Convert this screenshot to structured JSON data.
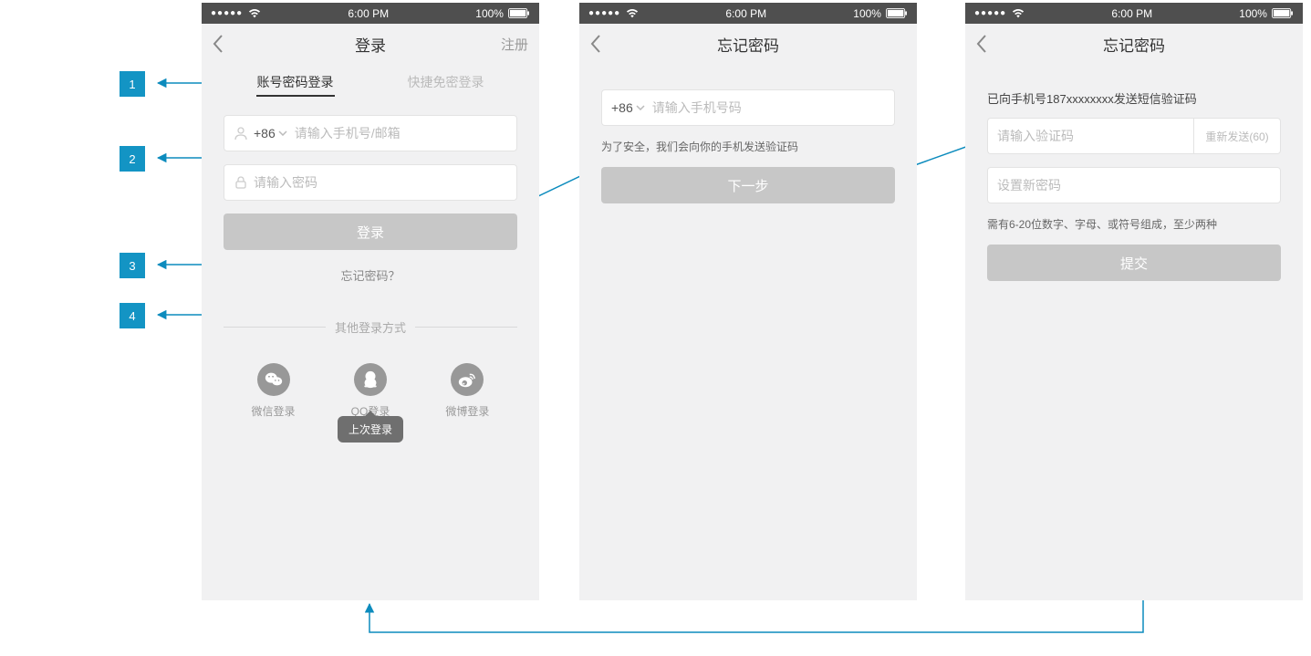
{
  "status": {
    "time": "6:00 PM",
    "battery": "100%"
  },
  "annotations": {
    "n1": "1",
    "n2": "2",
    "n3": "3",
    "n4": "4"
  },
  "login": {
    "title": "登录",
    "register": "注册",
    "tabs": {
      "password": "账号密码登录",
      "sms": "快捷免密登录"
    },
    "country": "+86",
    "phone_ph": "请输入手机号/邮箱",
    "pwd_ph": "请输入密码",
    "btn": "登录",
    "forgot": "忘记密码？",
    "other": "其他登录方式",
    "social": {
      "wechat": "微信登录",
      "qq": "QQ登录",
      "weibo": "微博登录"
    },
    "last_login": "上次登录"
  },
  "forgot1": {
    "title": "忘记密码",
    "country": "+86",
    "phone_ph": "请输入手机号码",
    "hint": "为了安全，我们会向你的手机发送验证码",
    "btn": "下一步"
  },
  "forgot2": {
    "title": "忘记密码",
    "sent": "已向手机号187xxxxxxxx发送短信验证码",
    "code_ph": "请输入验证码",
    "resend": "重新发送(60)",
    "pwd_ph": "设置新密码",
    "rule": "需有6-20位数字、字母、或符号组成，至少两种",
    "btn": "提交"
  }
}
